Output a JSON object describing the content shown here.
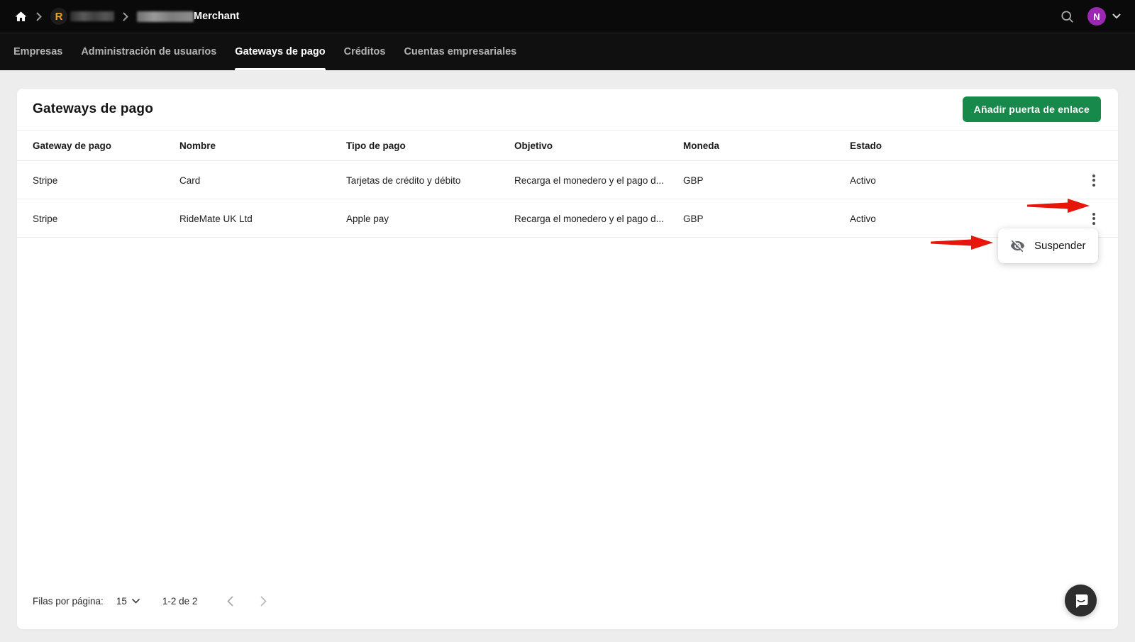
{
  "topbar": {
    "breadcrumb": {
      "org_initial": "R",
      "merchant_label": "Merchant"
    },
    "avatar_initial": "N"
  },
  "nav": {
    "tabs": [
      {
        "label": "Empresas"
      },
      {
        "label": "Administración de usuarios"
      },
      {
        "label": "Gateways de pago"
      },
      {
        "label": "Créditos"
      },
      {
        "label": "Cuentas empresariales"
      }
    ],
    "active_tab": "Gateways de pago"
  },
  "page": {
    "title": "Gateways de pago",
    "add_button": "Añadir puerta de enlace"
  },
  "table": {
    "columns": [
      "Gateway de pago",
      "Nombre",
      "Tipo de pago",
      "Objetivo",
      "Moneda",
      "Estado"
    ],
    "rows": [
      {
        "gateway": "Stripe",
        "nombre": "Card",
        "tipo": "Tarjetas de crédito y débito",
        "objetivo": "Recarga el monedero y el pago d...",
        "moneda": "GBP",
        "estado": "Activo"
      },
      {
        "gateway": "Stripe",
        "nombre": "RideMate UK Ltd",
        "tipo": "Apple pay",
        "objetivo": "Recarga el monedero y el pago d...",
        "moneda": "GBP",
        "estado": "Activo"
      }
    ]
  },
  "context_menu": {
    "suspend_label": "Suspender",
    "icon": "eye-off-icon"
  },
  "pagination": {
    "rows_per_page_label": "Filas por página:",
    "rows_per_page": "15",
    "range": "1-2 de 2"
  },
  "colors": {
    "accent_green": "#17894b",
    "arrow_red": "#e8150b",
    "avatar_purple": "#9c27b0",
    "logo_orange": "#f0a11c"
  }
}
